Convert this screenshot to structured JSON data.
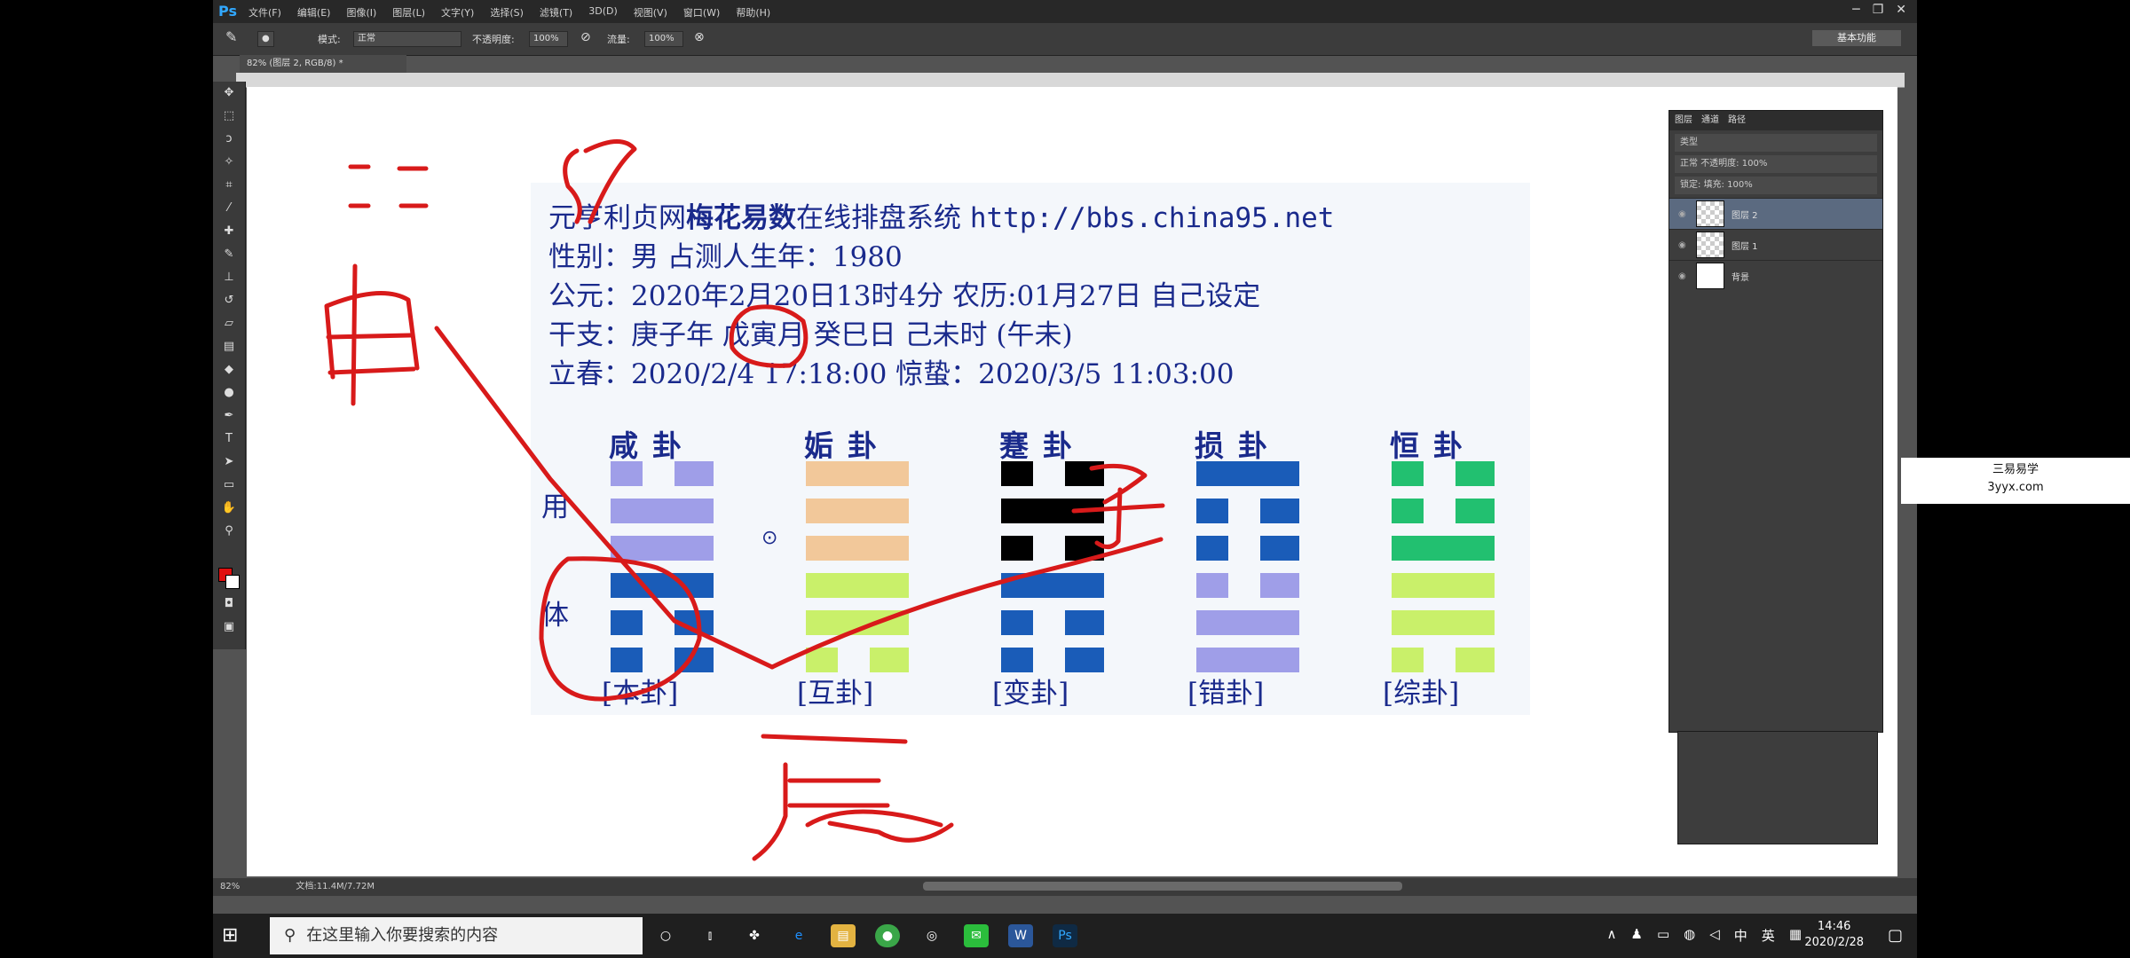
{
  "app": {
    "logo": "Ps",
    "menus": [
      "文件(F)",
      "编辑(E)",
      "图像(I)",
      "图层(L)",
      "文字(Y)",
      "选择(S)",
      "滤镜(T)",
      "3D(D)",
      "视图(V)",
      "窗口(W)",
      "帮助(H)"
    ],
    "workspace": "基本功能"
  },
  "options": {
    "mode_label": "模式:",
    "mode_value": "正常",
    "opacity_label": "不透明度:",
    "opacity_value": "100%",
    "flow_label": "流量:",
    "flow_value": "100%"
  },
  "doc_tab": "82% (图层 2, RGB/8) *",
  "content": {
    "line1_a": "元亨利贞网",
    "line1_b": "梅花易数",
    "line1_c": "在线排盘系统",
    "line1_url": "http://bbs.china95.net",
    "line2": "性别：男  占测人生年：1980",
    "line3": "公元：2020年2月20日13时4分  农历:01月27日  自己设定",
    "line4": "干支：庚子年  戊寅月  癸巳日  己未时  (午未)",
    "line5": "立春：2020/2/4 17:18:00  惊蛰：2020/3/5 11:03:00",
    "side_top": "用",
    "side_bottom": "体",
    "dot": "⊙"
  },
  "hexagrams": [
    {
      "name": "咸卦",
      "tag": "[本卦]",
      "color": "#9f9ee8",
      "color_lower": "#1a5cb8",
      "lines": [
        0,
        1,
        1,
        1,
        0,
        0
      ]
    },
    {
      "name": "姤卦",
      "tag": "[互卦]",
      "color": "#f2c89a",
      "color_lower": "#c9f06a",
      "lines": [
        1,
        1,
        1,
        1,
        1,
        0
      ]
    },
    {
      "name": "蹇卦",
      "tag": "[变卦]",
      "color": "#000000",
      "color_lower": "#1a5cb8",
      "lines": [
        0,
        1,
        0,
        1,
        0,
        0
      ]
    },
    {
      "name": "损卦",
      "tag": "[错卦]",
      "color": "#1a5cb8",
      "color_lower": "#9f9ee8",
      "lines": [
        1,
        0,
        0,
        0,
        1,
        1
      ]
    },
    {
      "name": "恒卦",
      "tag": "[综卦]",
      "color": "#22c070",
      "color_lower": "#c9f06a",
      "lines": [
        0,
        0,
        1,
        1,
        1,
        0
      ]
    }
  ],
  "layers": {
    "tabs": [
      "图层",
      "通道",
      "路径"
    ],
    "kind": "类型",
    "blend": "正常",
    "opacity_label": "不透明度:",
    "opacity_value": "100%",
    "lock_label": "锁定:",
    "fill_label": "填充:",
    "fill_value": "100%",
    "items": [
      {
        "name": "图层 2",
        "selected": true
      },
      {
        "name": "图层 1",
        "selected": false
      },
      {
        "name": "背景",
        "selected": false
      }
    ]
  },
  "watermark": {
    "line1": "三易易学",
    "line2": "3yyx.com"
  },
  "status": {
    "zoom": "82%",
    "doc": "文档:11.4M/7.72M"
  },
  "taskbar": {
    "search_placeholder": "在这里输入你要搜索的内容",
    "ime": "英",
    "time": "14:46",
    "date": "2020/2/28"
  },
  "ink": {
    "color": "#d81a1a",
    "characters": [
      "申",
      "子",
      "辰"
    ]
  }
}
